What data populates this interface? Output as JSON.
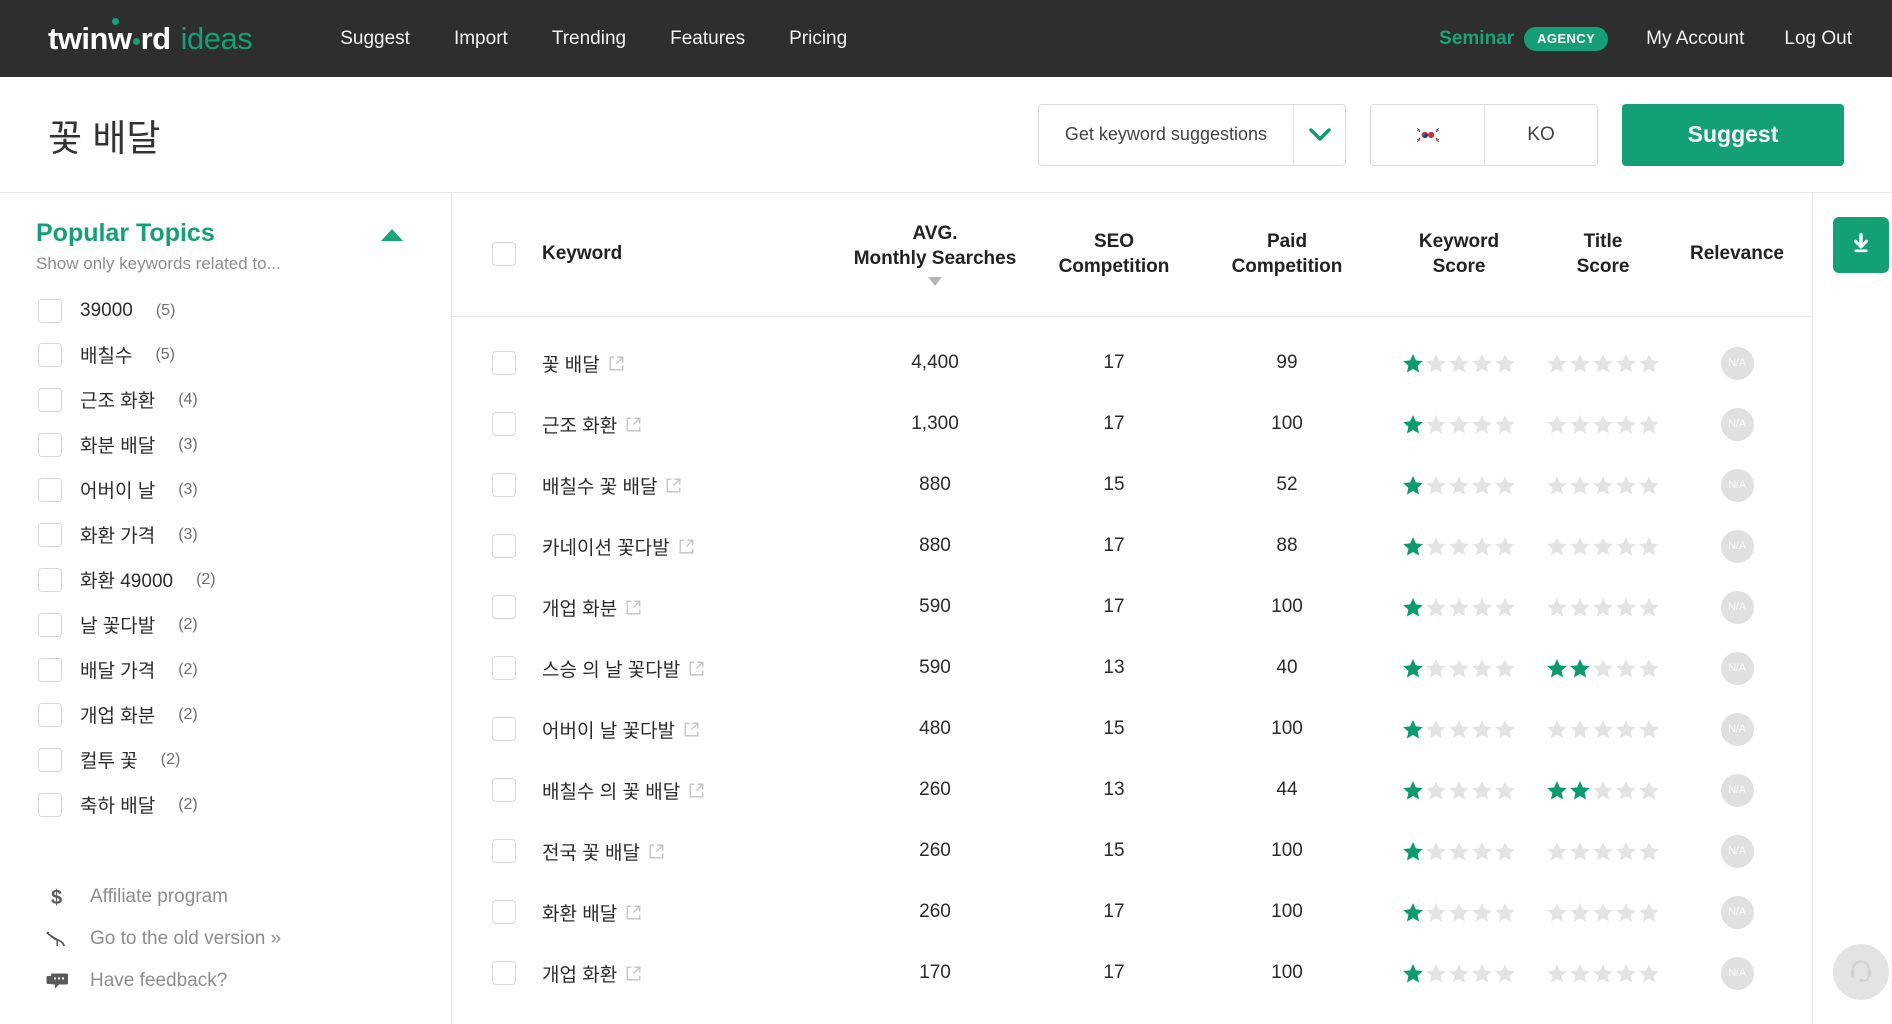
{
  "brand": {
    "logo_main": "twinw rd",
    "logo_sub": "ideas",
    "accent": "#14a077",
    "nav_bg": "#2e2e2e"
  },
  "topnav": {
    "links": [
      {
        "label": "Suggest"
      },
      {
        "label": "Import"
      },
      {
        "label": "Trending"
      },
      {
        "label": "Features"
      },
      {
        "label": "Pricing"
      }
    ],
    "account_name": "Seminar",
    "account_badge": "AGENCY",
    "my_account": "My Account",
    "log_out": "Log Out"
  },
  "search": {
    "page_title": "꽃 배달",
    "mode_label": "Get keyword suggestions",
    "flag_icon": "kr-flag-icon",
    "lang_code": "KO",
    "suggest_button": "Suggest"
  },
  "sidebar": {
    "title": "Popular Topics",
    "subtitle": "Show only keywords related to...",
    "collapse_icon": "chevron-up-icon",
    "topics": [
      {
        "label": "39000",
        "count": "(5)"
      },
      {
        "label": "배칠수",
        "count": "(5)"
      },
      {
        "label": "근조 화환",
        "count": "(4)"
      },
      {
        "label": "화분 배달",
        "count": "(3)"
      },
      {
        "label": "어버이 날",
        "count": "(3)"
      },
      {
        "label": "화환 가격",
        "count": "(3)"
      },
      {
        "label": "화환 49000",
        "count": "(2)"
      },
      {
        "label": "날 꽃다발",
        "count": "(2)"
      },
      {
        "label": "배달 가격",
        "count": "(2)"
      },
      {
        "label": "개업 화분",
        "count": "(2)"
      },
      {
        "label": "컬투 꽃",
        "count": "(2)"
      },
      {
        "label": "축하 배달",
        "count": "(2)"
      }
    ],
    "footer_links": [
      {
        "icon": "dollar-icon",
        "glyph": "$",
        "label": "Affiliate program"
      },
      {
        "icon": "dinosaur-icon",
        "glyph": "🦕",
        "label": "Go to the old version »"
      },
      {
        "icon": "feedback-icon",
        "glyph": "💬",
        "label": "Have feedback?"
      }
    ]
  },
  "table": {
    "columns": [
      {
        "key": "keyword",
        "label": "Keyword"
      },
      {
        "key": "avg_monthly",
        "label_top": "AVG.",
        "label_bottom": "Monthly Searches",
        "sorted": true,
        "sort_dir": "desc"
      },
      {
        "key": "seo_competition",
        "label_top": "SEO",
        "label_bottom": "Competition"
      },
      {
        "key": "paid_competition",
        "label_top": "Paid",
        "label_bottom": "Competition"
      },
      {
        "key": "keyword_score",
        "label_top": "Keyword",
        "label_bottom": "Score"
      },
      {
        "key": "title_score",
        "label_top": "Title",
        "label_bottom": "Score"
      },
      {
        "key": "relevance",
        "label": "Relevance"
      }
    ],
    "rows": [
      {
        "keyword": "꽃 배달",
        "avg_monthly": "4,400",
        "seo_competition": "17",
        "paid_competition": "99",
        "keyword_score": 1,
        "title_score": 0,
        "relevance": "N/A"
      },
      {
        "keyword": "근조 화환",
        "avg_monthly": "1,300",
        "seo_competition": "17",
        "paid_competition": "100",
        "keyword_score": 1,
        "title_score": 0,
        "relevance": "N/A"
      },
      {
        "keyword": "배칠수 꽃 배달",
        "avg_monthly": "880",
        "seo_competition": "15",
        "paid_competition": "52",
        "keyword_score": 1,
        "title_score": 0,
        "relevance": "N/A"
      },
      {
        "keyword": "카네이션 꽃다발",
        "avg_monthly": "880",
        "seo_competition": "17",
        "paid_competition": "88",
        "keyword_score": 1,
        "title_score": 0,
        "relevance": "N/A"
      },
      {
        "keyword": "개업 화분",
        "avg_monthly": "590",
        "seo_competition": "17",
        "paid_competition": "100",
        "keyword_score": 1,
        "title_score": 0,
        "relevance": "N/A"
      },
      {
        "keyword": "스승 의 날 꽃다발",
        "avg_monthly": "590",
        "seo_competition": "13",
        "paid_competition": "40",
        "keyword_score": 1,
        "title_score": 2,
        "relevance": "N/A"
      },
      {
        "keyword": "어버이 날 꽃다발",
        "avg_monthly": "480",
        "seo_competition": "15",
        "paid_competition": "100",
        "keyword_score": 1,
        "title_score": 0,
        "relevance": "N/A"
      },
      {
        "keyword": "배칠수 의 꽃 배달",
        "avg_monthly": "260",
        "seo_competition": "13",
        "paid_competition": "44",
        "keyword_score": 1,
        "title_score": 2,
        "relevance": "N/A"
      },
      {
        "keyword": "전국 꽃 배달",
        "avg_monthly": "260",
        "seo_competition": "15",
        "paid_competition": "100",
        "keyword_score": 1,
        "title_score": 0,
        "relevance": "N/A"
      },
      {
        "keyword": "화환 배달",
        "avg_monthly": "260",
        "seo_competition": "17",
        "paid_competition": "100",
        "keyword_score": 1,
        "title_score": 0,
        "relevance": "N/A"
      },
      {
        "keyword": "개업 화환",
        "avg_monthly": "170",
        "seo_competition": "17",
        "paid_competition": "100",
        "keyword_score": 1,
        "title_score": 0,
        "relevance": "N/A"
      }
    ]
  },
  "rail": {
    "download_icon": "download-icon",
    "support_icon": "headset-icon"
  }
}
